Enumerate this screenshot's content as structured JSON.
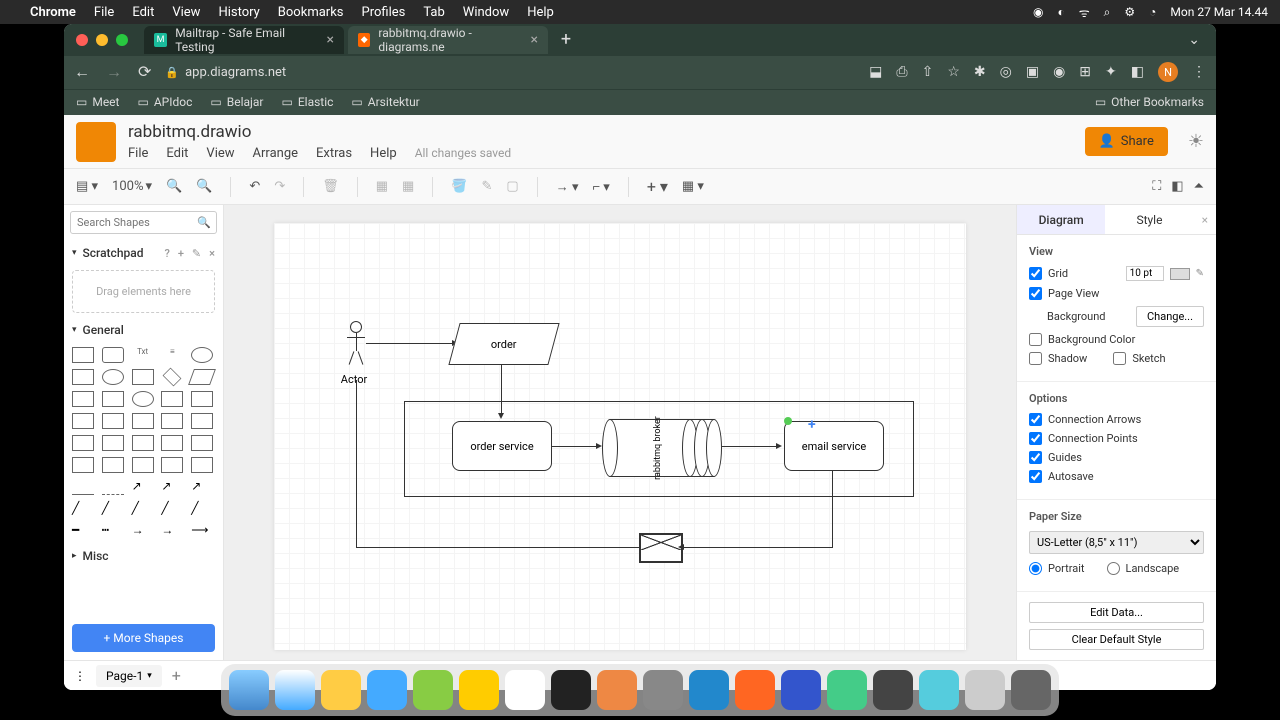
{
  "menubar": {
    "app": "Chrome",
    "items": [
      "File",
      "Edit",
      "View",
      "History",
      "Bookmarks",
      "Profiles",
      "Tab",
      "Window",
      "Help"
    ],
    "clock": "Mon 27 Mar 14.44"
  },
  "tabs": [
    {
      "title": "Mailtrap - Safe Email Testing",
      "active": false
    },
    {
      "title": "rabbitmq.drawio - diagrams.ne",
      "active": true
    }
  ],
  "url": "app.diagrams.net",
  "bookmarks": [
    "Meet",
    "APIdoc",
    "Belajar",
    "Elastic",
    "Arsitektur"
  ],
  "other_bookmarks": "Other Bookmarks",
  "app": {
    "title": "rabbitmq.drawio",
    "menu": [
      "File",
      "Edit",
      "View",
      "Arrange",
      "Extras",
      "Help"
    ],
    "saved": "All changes saved",
    "share": "Share",
    "zoom": "100%"
  },
  "left": {
    "search_ph": "Search Shapes",
    "scratchpad": "Scratchpad",
    "drag": "Drag elements here",
    "general": "General",
    "misc": "Misc",
    "more": "+ More Shapes"
  },
  "diagram": {
    "actor": "Actor",
    "order": "order",
    "order_service": "order service",
    "broker": "rabbitmq broker",
    "email_service": "email service"
  },
  "right": {
    "tabs": [
      "Diagram",
      "Style"
    ],
    "view": "View",
    "grid": "Grid",
    "grid_val": "10 pt",
    "page_view": "Page View",
    "background": "Background",
    "change": "Change...",
    "bg_color": "Background Color",
    "shadow": "Shadow",
    "sketch": "Sketch",
    "options": "Options",
    "conn_arrows": "Connection Arrows",
    "conn_points": "Connection Points",
    "guides": "Guides",
    "autosave": "Autosave",
    "paper": "Paper Size",
    "paper_val": "US-Letter (8,5\" x 11\")",
    "portrait": "Portrait",
    "landscape": "Landscape",
    "edit_data": "Edit Data...",
    "clear_style": "Clear Default Style"
  },
  "bottom": {
    "page": "Page-1"
  }
}
